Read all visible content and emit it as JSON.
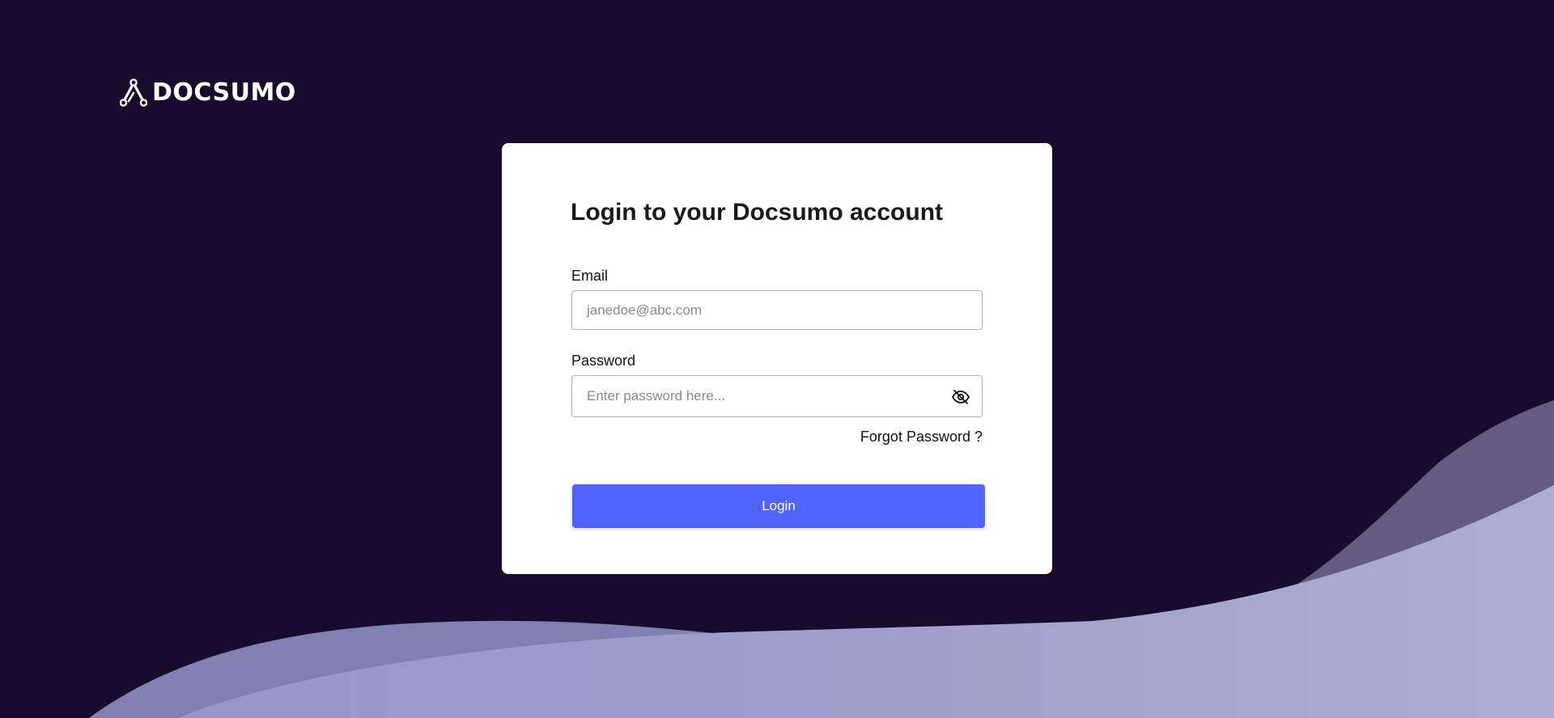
{
  "brand": {
    "name": "DOCSUMO"
  },
  "login_card": {
    "title": "Login to your Docsumo account",
    "email": {
      "label": "Email",
      "value": "",
      "placeholder": "janedoe@abc.com"
    },
    "password": {
      "label": "Password",
      "value": "",
      "placeholder": "Enter password here...",
      "toggle_icon": "eye-off-icon"
    },
    "forgot_password_label": "Forgot Password ?",
    "login_button_label": "Login"
  },
  "colors": {
    "background": "#170c2e",
    "accent": "#4f63ff",
    "wave_back": "#645c80",
    "wave_front": "#a5a6ce"
  }
}
